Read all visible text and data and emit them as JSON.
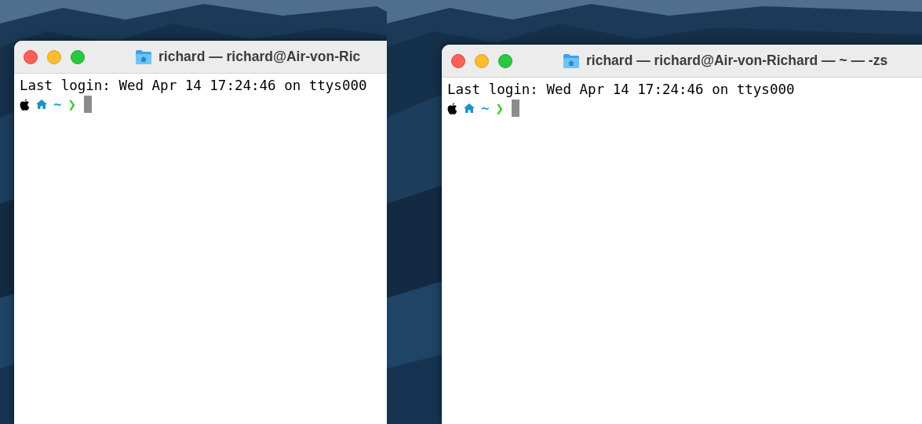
{
  "panels": [
    {
      "window": {
        "title": "richard — richard@Air-von-Ric"
      },
      "terminal": {
        "lines": [
          "Last login: Wed Apr 14 17:24:46 on ttys000"
        ],
        "prompt": {
          "path": "~",
          "arrow": "❯"
        }
      }
    },
    {
      "window": {
        "title": "richard — richard@Air-von-Richard — ~ — -zs"
      },
      "terminal": {
        "lines": [
          "Last login: Wed Apr 14 17:24:46 on ttys000"
        ],
        "prompt": {
          "path": "~",
          "arrow": "❯"
        }
      }
    }
  ]
}
